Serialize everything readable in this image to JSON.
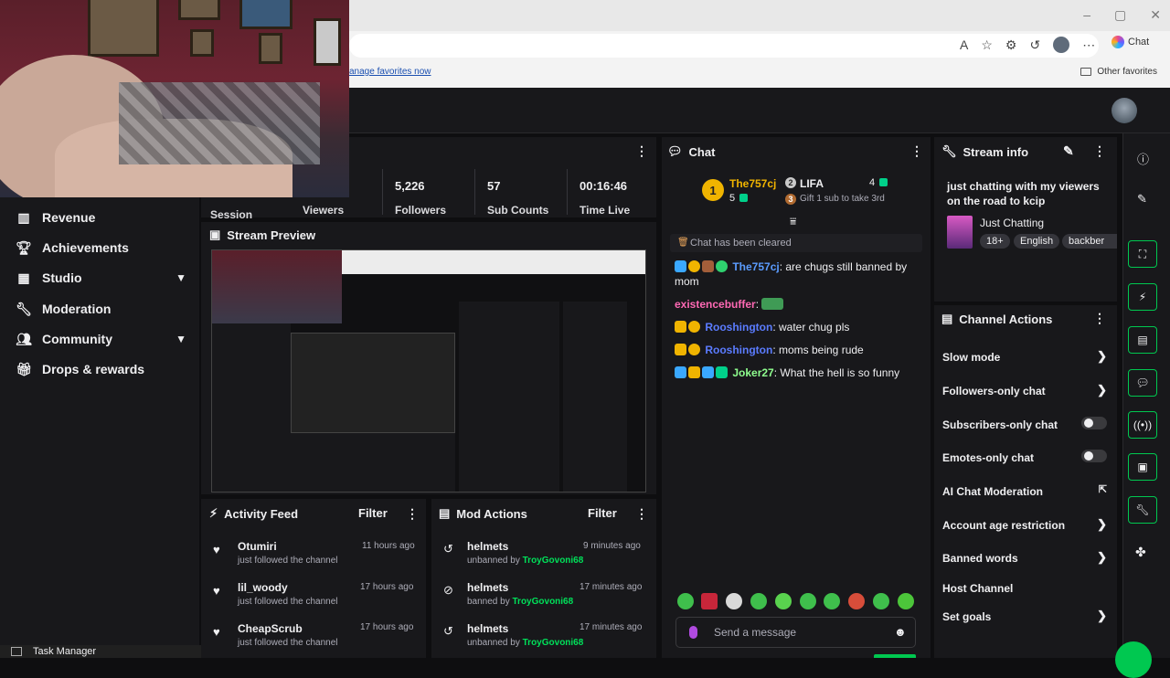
{
  "browser": {
    "copilot_label": "Chat",
    "fav_link": "anage favorites now",
    "other_favorites": "Other favorites"
  },
  "sidebar": {
    "items": [
      {
        "label": "Revenue",
        "icon": "bar-chart-icon"
      },
      {
        "label": "Achievements",
        "icon": "trophy-icon"
      },
      {
        "label": "Studio",
        "icon": "film-icon",
        "expandable": true
      },
      {
        "label": "Moderation",
        "icon": "wrench-icon"
      },
      {
        "label": "Community",
        "icon": "people-icon",
        "expandable": true
      },
      {
        "label": "Drops & rewards",
        "icon": "gift-icon"
      }
    ]
  },
  "stats": {
    "session_label": "Session",
    "viewers_label": "Viewers",
    "followers_value": "5,226",
    "followers_label": "Followers",
    "subs_value": "57",
    "subs_label": "Sub Counts",
    "time_value": "00:16:46",
    "time_label": "Time Live"
  },
  "preview": {
    "title": "Stream Preview"
  },
  "activity": {
    "title": "Activity Feed",
    "filter": "Filter",
    "items": [
      {
        "name": "Otumiri",
        "sub": "just followed the channel",
        "time": "11 hours ago"
      },
      {
        "name": "lil_woody",
        "sub": "just followed the channel",
        "time": "17 hours ago"
      },
      {
        "name": "CheapScrub",
        "sub": "just followed the channel",
        "time": "17 hours ago"
      }
    ]
  },
  "mod_actions": {
    "title": "Mod Actions",
    "filter": "Filter",
    "items": [
      {
        "name": "helmets",
        "action": "unbanned by",
        "by": "TroyGovoni68",
        "time": "9 minutes ago"
      },
      {
        "name": "helmets",
        "action": "banned by",
        "by": "TroyGovoni68",
        "time": "17 minutes ago"
      },
      {
        "name": "helmets",
        "action": "unbanned by",
        "by": "TroyGovoni68",
        "time": "17 minutes ago"
      }
    ]
  },
  "chat": {
    "title": "Chat",
    "leader_name": "The757cj",
    "leader_count": "5",
    "second_name": "LIFA",
    "second_count": "4",
    "gift_prompt": "Gift 1 sub to take 3rd",
    "cleared": "Chat has been cleared",
    "messages": [
      {
        "user": "The757cj",
        "color": "#5b9cff",
        "text": ": are chugs still banned by mom"
      },
      {
        "user": "existencebuffer",
        "color": "#ff69b4",
        "text": ":"
      },
      {
        "user": "Rooshington",
        "color": "#5b7cff",
        "text": ": water chug pls"
      },
      {
        "user": "Rooshington",
        "color": "#5b7cff",
        "text": ": moms being rude"
      },
      {
        "user": "Joker27",
        "color": "#8fff8f",
        "text": ": What the hell is so funny"
      }
    ],
    "placeholder": "Send a message"
  },
  "stream_info": {
    "title": "Stream info",
    "stream_title": "just chatting with my viewers on the road to kcip",
    "category": "Just Chatting",
    "tags": [
      "18+",
      "English",
      "backber"
    ]
  },
  "channel_actions": {
    "title": "Channel Actions",
    "rows": [
      {
        "label": "Slow mode",
        "control": "chevron"
      },
      {
        "label": "Followers-only chat",
        "control": "chevron"
      },
      {
        "label": "Subscribers-only chat",
        "control": "toggle"
      },
      {
        "label": "Emotes-only chat",
        "control": "toggle"
      },
      {
        "label": "AI Chat Moderation",
        "control": "external"
      },
      {
        "label": "Account age restriction",
        "control": "chevron"
      },
      {
        "label": "Banned words",
        "control": "chevron"
      },
      {
        "label": "Host Channel",
        "control": "none"
      },
      {
        "label": "Set goals",
        "control": "chevron"
      }
    ]
  },
  "taskbar": {
    "task_manager": "Task Manager"
  },
  "colors": {
    "accent": "#00c850",
    "panel": "#18181b",
    "background": "#0e0e10"
  }
}
